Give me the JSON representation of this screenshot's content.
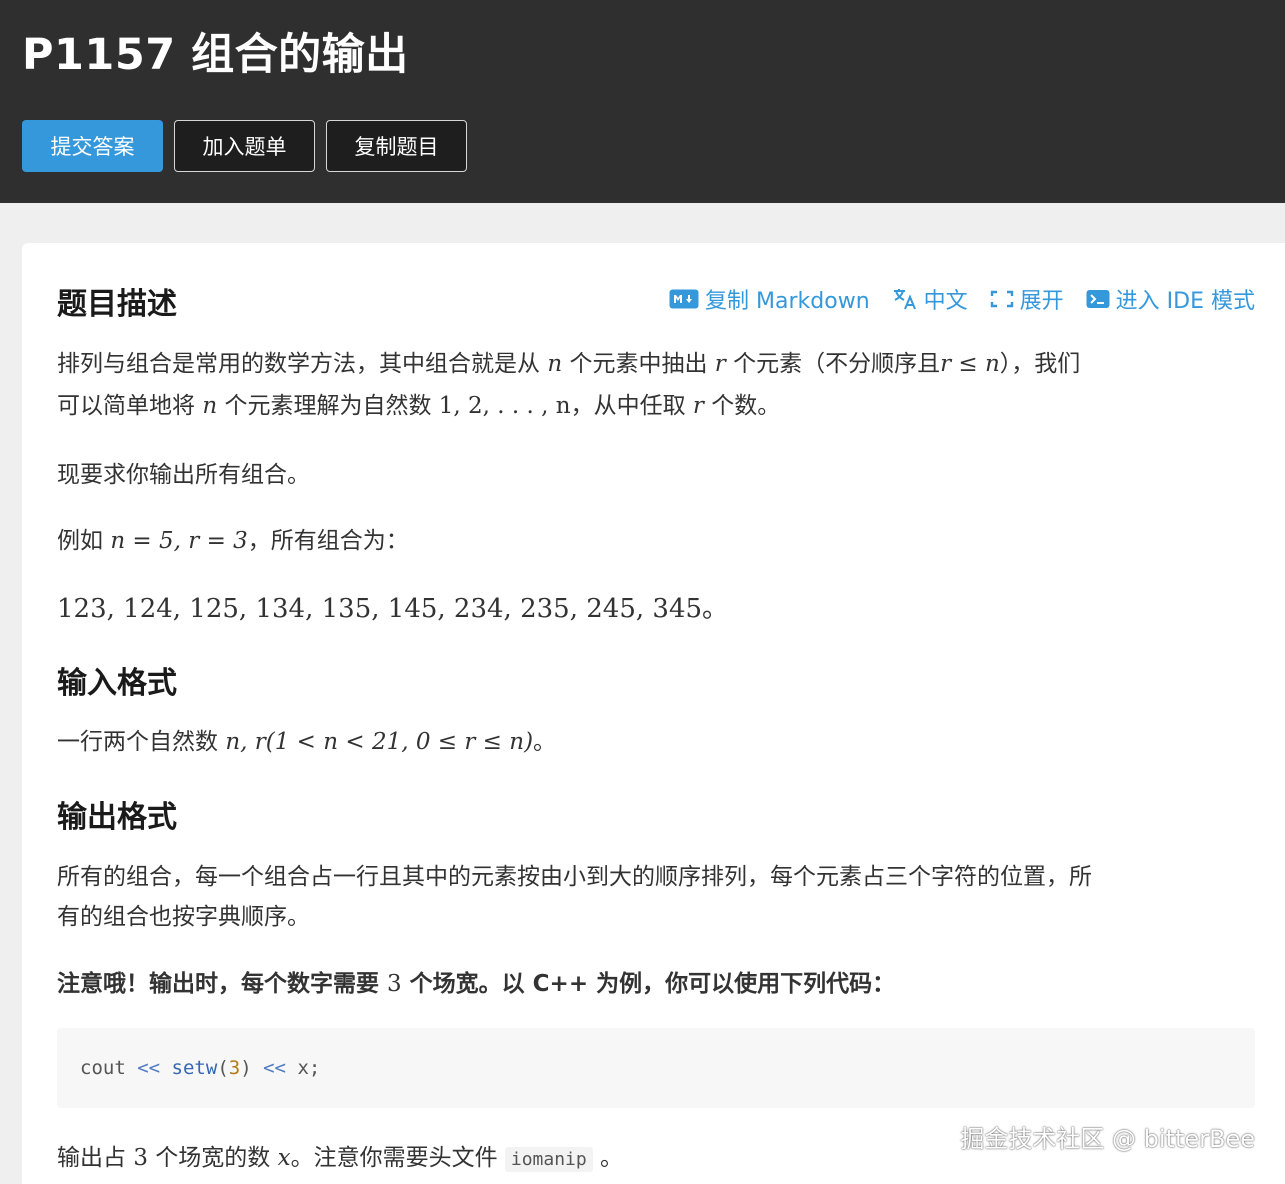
{
  "header": {
    "title": "P1157 组合的输出",
    "buttons": {
      "submit": "提交答案",
      "join_list": "加入题单",
      "copy_problem": "复制题目"
    }
  },
  "actions": {
    "copy_markdown": "复制 Markdown",
    "language": "中文",
    "expand": "展开",
    "ide_mode": "进入 IDE 模式"
  },
  "description": {
    "heading": "题目描述",
    "p1a": "排列与组合是常用的数学方法，其中组合就是从",
    "p1b": "个元素中抽出",
    "p1c": "个元素（不分顺序且",
    "p1d": "），我们",
    "p2a": "可以简单地将",
    "p2b": "个元素理解为自然数",
    "p2c": "，从中任取",
    "p2d": "个数。",
    "p3": "现要求你输出所有组合。",
    "p4a": "例如",
    "p4b": "，所有组合为：",
    "p5_math": "123, 124, 125, 134, 135, 145, 234, 235, 245, 345",
    "p5_end": "。"
  },
  "math": {
    "n": "n",
    "r": "r",
    "r_le_n": "r ≤ n",
    "seq": "1, 2, . . . , n",
    "example": "n = 5, r = 3",
    "x": "x",
    "three": "3",
    "input_cond": "n, r(1 < n < 21, 0 ≤ r ≤ n)"
  },
  "input": {
    "heading": "输入格式",
    "text": "一行两个自然数",
    "end": "。"
  },
  "output": {
    "heading": "输出格式",
    "p1a": "所有的组合，每一个组合占一行且其中的元素按由小到大的顺序排列，每个元素占三个字符的位置，所",
    "p1b": "有的组合也按字典顺序。",
    "note_a": "注意哦！输出时，每个数字需要",
    "note_b": "个场宽。以 C++ 为例，你可以使用下列代码：",
    "last_a": "输出占",
    "last_b": "个场宽的数",
    "last_c": "。注意你需要头文件",
    "last_d": "。",
    "header_file": "iomanip"
  },
  "code": {
    "t1": "cout ",
    "t2": "<<",
    "t3": " ",
    "t4": "setw",
    "t5": "(",
    "t6": "3",
    "t7": ") ",
    "t8": "<<",
    "t9": " x;"
  },
  "watermark": "掘金技术社区 @ bitterBee",
  "colors": {
    "header_bg": "#2f2f30",
    "accent": "#3498db",
    "page_bg": "#efefef"
  }
}
